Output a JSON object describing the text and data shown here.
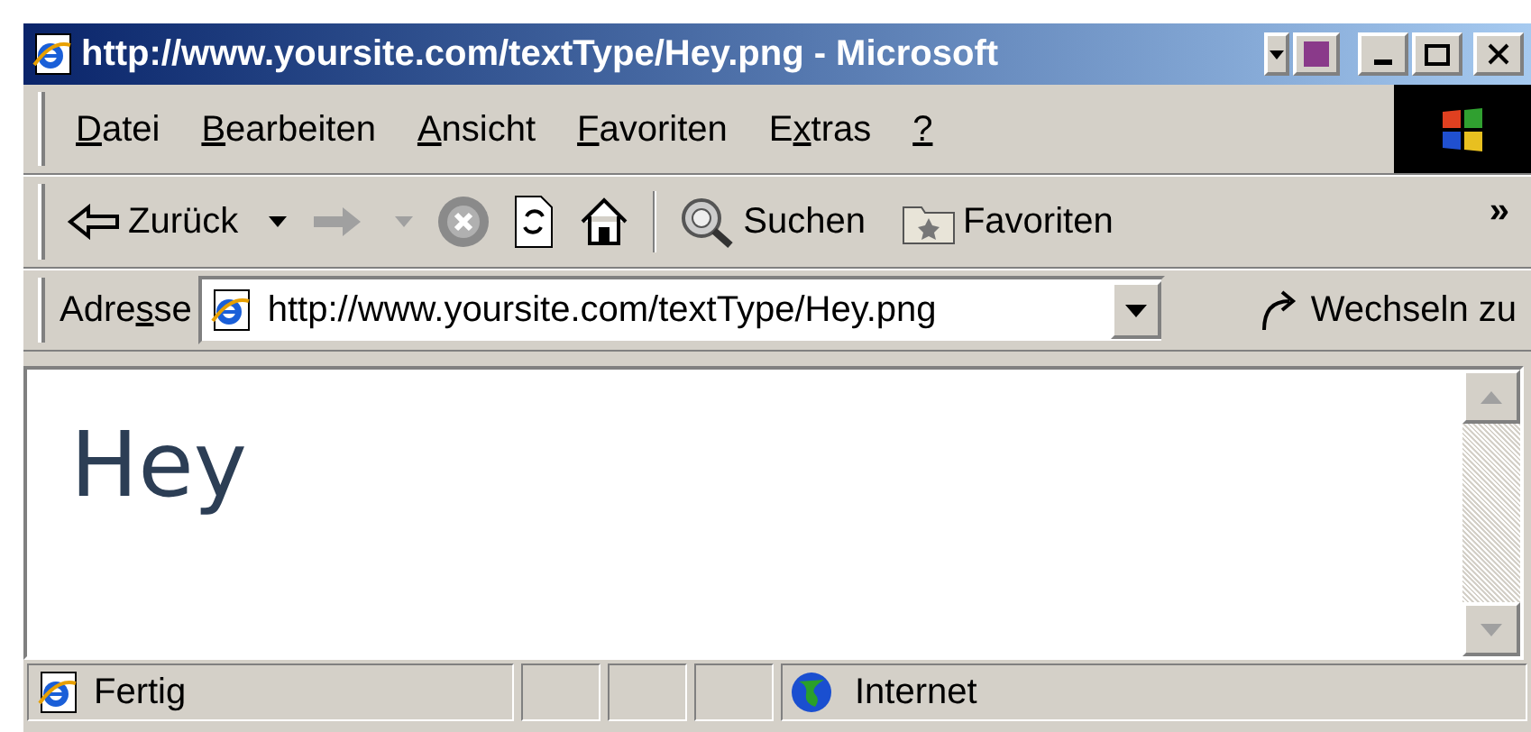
{
  "window": {
    "title": "http://www.yoursite.com/textType/Hey.png - Microsoft"
  },
  "menu": [
    {
      "key": "D",
      "post": "atei"
    },
    {
      "key": "B",
      "post": "earbeiten"
    },
    {
      "key": "A",
      "post": "nsicht"
    },
    {
      "key": "F",
      "post": "avoriten"
    },
    {
      "pre": "E",
      "key": "x",
      "post": "tras"
    },
    {
      "key": "?"
    }
  ],
  "toolbar": [
    {
      "kind": "back",
      "label": "Zurück",
      "disabled": false
    },
    {
      "kind": "forward",
      "disabled": true
    },
    {
      "kind": "stop"
    },
    {
      "kind": "refresh"
    },
    {
      "kind": "home"
    },
    {
      "kind": "sep"
    },
    {
      "kind": "search",
      "label": "Suchen"
    },
    {
      "kind": "favorites",
      "label": "Favoriten"
    }
  ],
  "toolbar_more": "»",
  "address": {
    "label": {
      "pre": "Adre",
      "key": "s",
      "post": "se"
    },
    "value": "http://www.yoursite.com/textType/Hey.png",
    "go": "Wechseln zu"
  },
  "content": {
    "text": "Hey"
  },
  "status_bar": {
    "text": "Fertig",
    "zone": "Internet"
  }
}
